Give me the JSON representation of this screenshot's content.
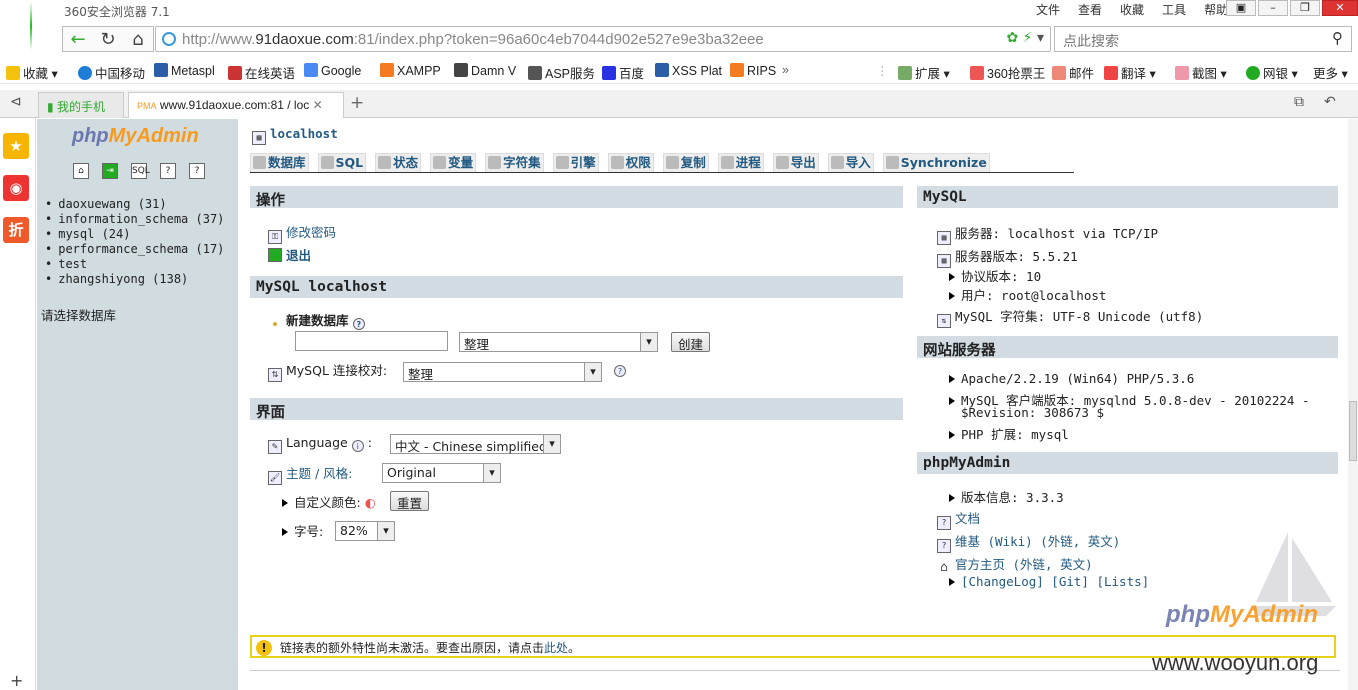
{
  "browser": {
    "title": "360安全浏览器 7.1",
    "menu": [
      "文件",
      "查看",
      "收藏",
      "工具",
      "帮助"
    ],
    "url_prefix": "http://www.",
    "url_domain": "91daoxue.com",
    "url_rest": ":81/index.php?token=96a60c4eb7044d902e527e9e3ba32eee",
    "search_placeholder": "点此搜索",
    "bookmarks_left": [
      "收藏",
      "中国移动",
      "Metaspl",
      "在线英语",
      "Google",
      "XAMPP",
      "Damn V",
      "ASP服务",
      "百度",
      "XSS Plat",
      "RIPS"
    ],
    "bookmarks_right": [
      "扩展",
      "360抢票王",
      "邮件",
      "翻译",
      "截图",
      "网银",
      "更多"
    ],
    "tabs": [
      "我的手机",
      "www.91daoxue.com:81 / loc"
    ]
  },
  "pma": {
    "logo_php": "php",
    "logo_ma": "MyAdmin",
    "databases": [
      "daoxuewang (31)",
      "information_schema (37)",
      "mysql (24)",
      "performance_schema (17)",
      "test",
      "zhangshiyong (138)"
    ],
    "choose_db": "请选择数据库",
    "server": "localhost",
    "tabs": [
      "数据库",
      "SQL",
      "状态",
      "变量",
      "字符集",
      "引擎",
      "权限",
      "复制",
      "进程",
      "导出",
      "导入",
      "Synchronize"
    ],
    "actions": {
      "title": "操作",
      "change_password": "修改密码",
      "logout": "退出"
    },
    "mysql_local": {
      "title": "MySQL localhost",
      "new_db_label": "新建数据库",
      "collation_select": "整理",
      "create_button": "创建",
      "conn_collation_label": "MySQL 连接校对:",
      "conn_collation_value": "整理"
    },
    "interface": {
      "title": "界面",
      "language_label": "Language",
      "language_value": "中文 - Chinese simplified",
      "theme_label": "主题 / 风格:",
      "theme_value": "Original",
      "custom_color_label": "自定义颜色:",
      "reset_button": "重置",
      "font_size_label": "字号:",
      "font_size_value": "82%"
    },
    "mysql_info": {
      "title": "MySQL",
      "server": "服务器: localhost via TCP/IP",
      "version": "服务器版本: 5.5.21",
      "protocol": "协议版本: 10",
      "user": "用户: root@localhost",
      "charset": "MySQL 字符集: UTF-8 Unicode (utf8)"
    },
    "web_server": {
      "title": "网站服务器",
      "apache": "Apache/2.2.19 (Win64) PHP/5.3.6",
      "client_line1": "MySQL 客户端版本: mysqlnd 5.0.8-dev - 20102224 -",
      "client_line2": "$Revision: 308673 $",
      "php_ext": "PHP 扩展: mysql"
    },
    "pma_info": {
      "title": "phpMyAdmin",
      "version": "版本信息: 3.3.3",
      "docs": "文档",
      "wiki": "维基 (Wiki) (外链, 英文)",
      "homepage": "官方主页 (外链, 英文)",
      "changelog": "[ChangeLog] [Git] [Lists]"
    },
    "notice_text": "链接表的额外特性尚未激活。要查出原因，请点击",
    "notice_link": "此处",
    "notice_end": "。"
  },
  "watermark": {
    "php": "php",
    "ma": "MyAdmin",
    "site": "www.wooyun.org"
  }
}
